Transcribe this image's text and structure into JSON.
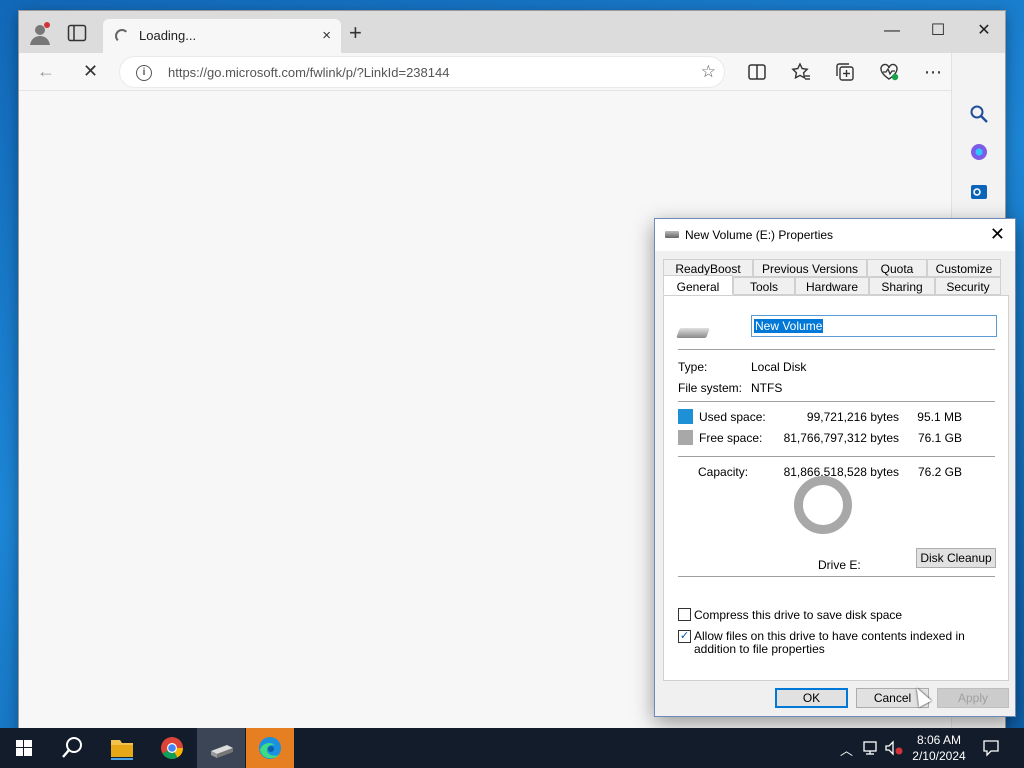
{
  "browser": {
    "tab_title": "Loading...",
    "url": "https://go.microsoft.com/fwlink/p/?LinkId=238144",
    "icons": {
      "profile": "profile-icon",
      "tab_actions": "tab-actions-icon",
      "new_tab": "+",
      "tab_close": "×",
      "back": "←",
      "stop": "✕",
      "info": "i",
      "favorite": "☆",
      "split": "split-screen-icon",
      "favorites": "favorites-icon",
      "collections": "collections-icon",
      "browser_essentials": "heart-pulse-icon",
      "more": "⋯",
      "bing": "bing-icon"
    },
    "window_controls": {
      "minimize": "—",
      "maximize": "☐",
      "close": "✕"
    }
  },
  "dialog": {
    "title": "New Volume (E:) Properties",
    "close": "✕",
    "tabs_row1": [
      "ReadyBoost",
      "Previous Versions",
      "Quota",
      "Customize"
    ],
    "tabs_row2": [
      "General",
      "Tools",
      "Hardware",
      "Sharing",
      "Security"
    ],
    "volume_name": "New Volume",
    "type_label": "Type:",
    "type_value": "Local Disk",
    "fs_label": "File system:",
    "fs_value": "NTFS",
    "used_label": "Used space:",
    "used_bytes": "99,721,216 bytes",
    "used_size": "95.1 MB",
    "free_label": "Free space:",
    "free_bytes": "81,766,797,312 bytes",
    "free_size": "76.1 GB",
    "capacity_label": "Capacity:",
    "capacity_bytes": "81,866,518,528 bytes",
    "capacity_size": "76.2 GB",
    "drive_label": "Drive E:",
    "disk_cleanup": "Disk Cleanup",
    "compress_label": "Compress this drive to save disk space",
    "compress_checked": false,
    "index_label": "Allow files on this drive to have contents indexed in addition to file properties",
    "index_checked": true,
    "check_mark": "✓",
    "ok": "OK",
    "cancel": "Cancel",
    "apply": "Apply",
    "colors": {
      "used": "#1e90d6",
      "free": "#a8a8a8"
    },
    "used_fraction": 0.0012
  },
  "taskbar": {
    "time": "8:06 AM",
    "date": "2/10/2024",
    "apps": [
      "start-icon",
      "search-icon",
      "file-explorer-icon",
      "chrome-icon",
      "drive-app-icon",
      "edge-icon"
    ]
  }
}
